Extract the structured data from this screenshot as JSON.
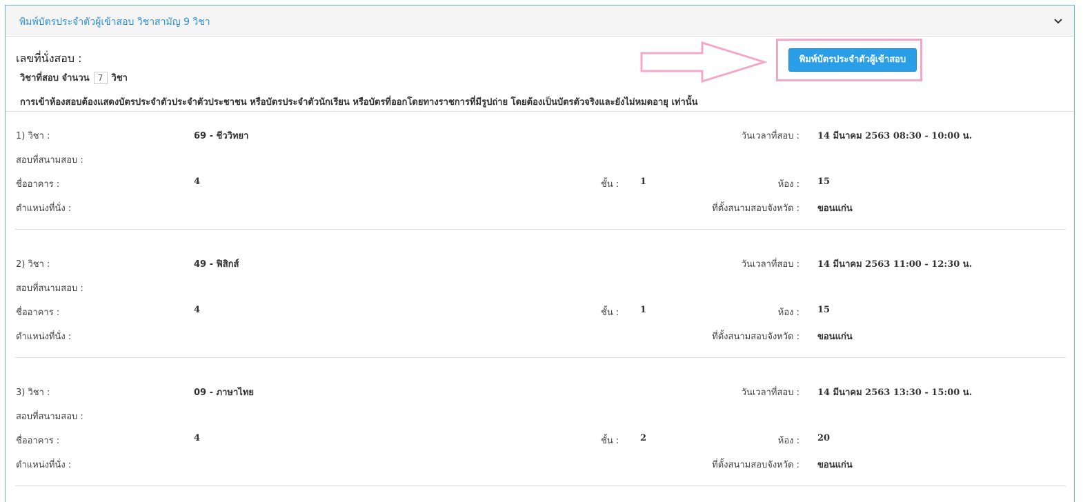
{
  "panel": {
    "title": "พิมพ์บัตรประจำตัวผู้เข้าสอบ วิชาสามัญ 9 วิชา",
    "toggle_icon": "chevron-down-icon"
  },
  "info": {
    "seat_label": "เลขที่นั่งสอบ :",
    "count_prefix": "วิชาที่สอบ จำนวน",
    "count_value": "7",
    "count_suffix": "วิชา",
    "notice": "การเข้าห้องสอบต้องแสดงบัตรประจำตัวประจำตัวประชาชน หรือบัตรประจำตัวนักเรียน หรือบัตรที่ออกโดยทางราชการที่มีรูปถ่าย โดยต้องเป็นบัตรตัวจริงและยังไม่หมดอายุ เท่านั้น",
    "print_button_label": "พิมพ์บัตรประจำตัวผู้เข้าสอบ",
    "annotation_color": "#f4a7c9"
  },
  "labels": {
    "datetime": "วันเวลาที่สอบ :",
    "venue": "สอบที่สนามสอบ :",
    "building": "ชื่ออาคาร :",
    "floor": "ชั้น :",
    "room": "ห้อง :",
    "seat_position": "ตำแหน่งที่นั่ง :",
    "province": "ที่ตั้งสนามสอบจังหวัด :"
  },
  "subjects": [
    {
      "heading": "1) วิชา :",
      "name": "69 - ชีววิทยา",
      "datetime": "14 มีนาคม 2563 08:30 - 10:00 น.",
      "building": "4",
      "floor": "1",
      "room": "15",
      "province": "ขอนแก่น"
    },
    {
      "heading": "2) วิชา :",
      "name": "49 - ฟิสิกส์",
      "datetime": "14 มีนาคม 2563 11:00 - 12:30 น.",
      "building": "4",
      "floor": "1",
      "room": "15",
      "province": "ขอนแก่น"
    },
    {
      "heading": "3) วิชา :",
      "name": "09 - ภาษาไทย",
      "datetime": "14 มีนาคม 2563 13:30 - 15:00 น.",
      "building": "4",
      "floor": "2",
      "room": "20",
      "province": "ขอนแก่น"
    }
  ]
}
